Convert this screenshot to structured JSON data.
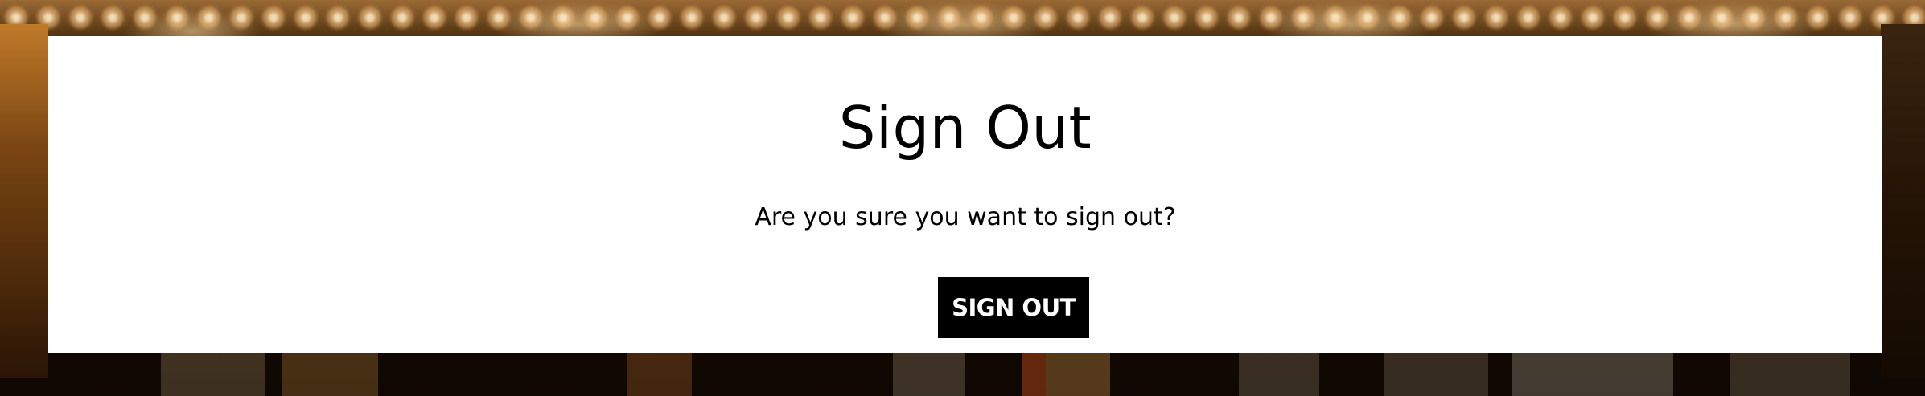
{
  "signout": {
    "title": "Sign Out",
    "prompt": "Are you sure you want to sign out?",
    "button_label": "SIGN OUT"
  }
}
